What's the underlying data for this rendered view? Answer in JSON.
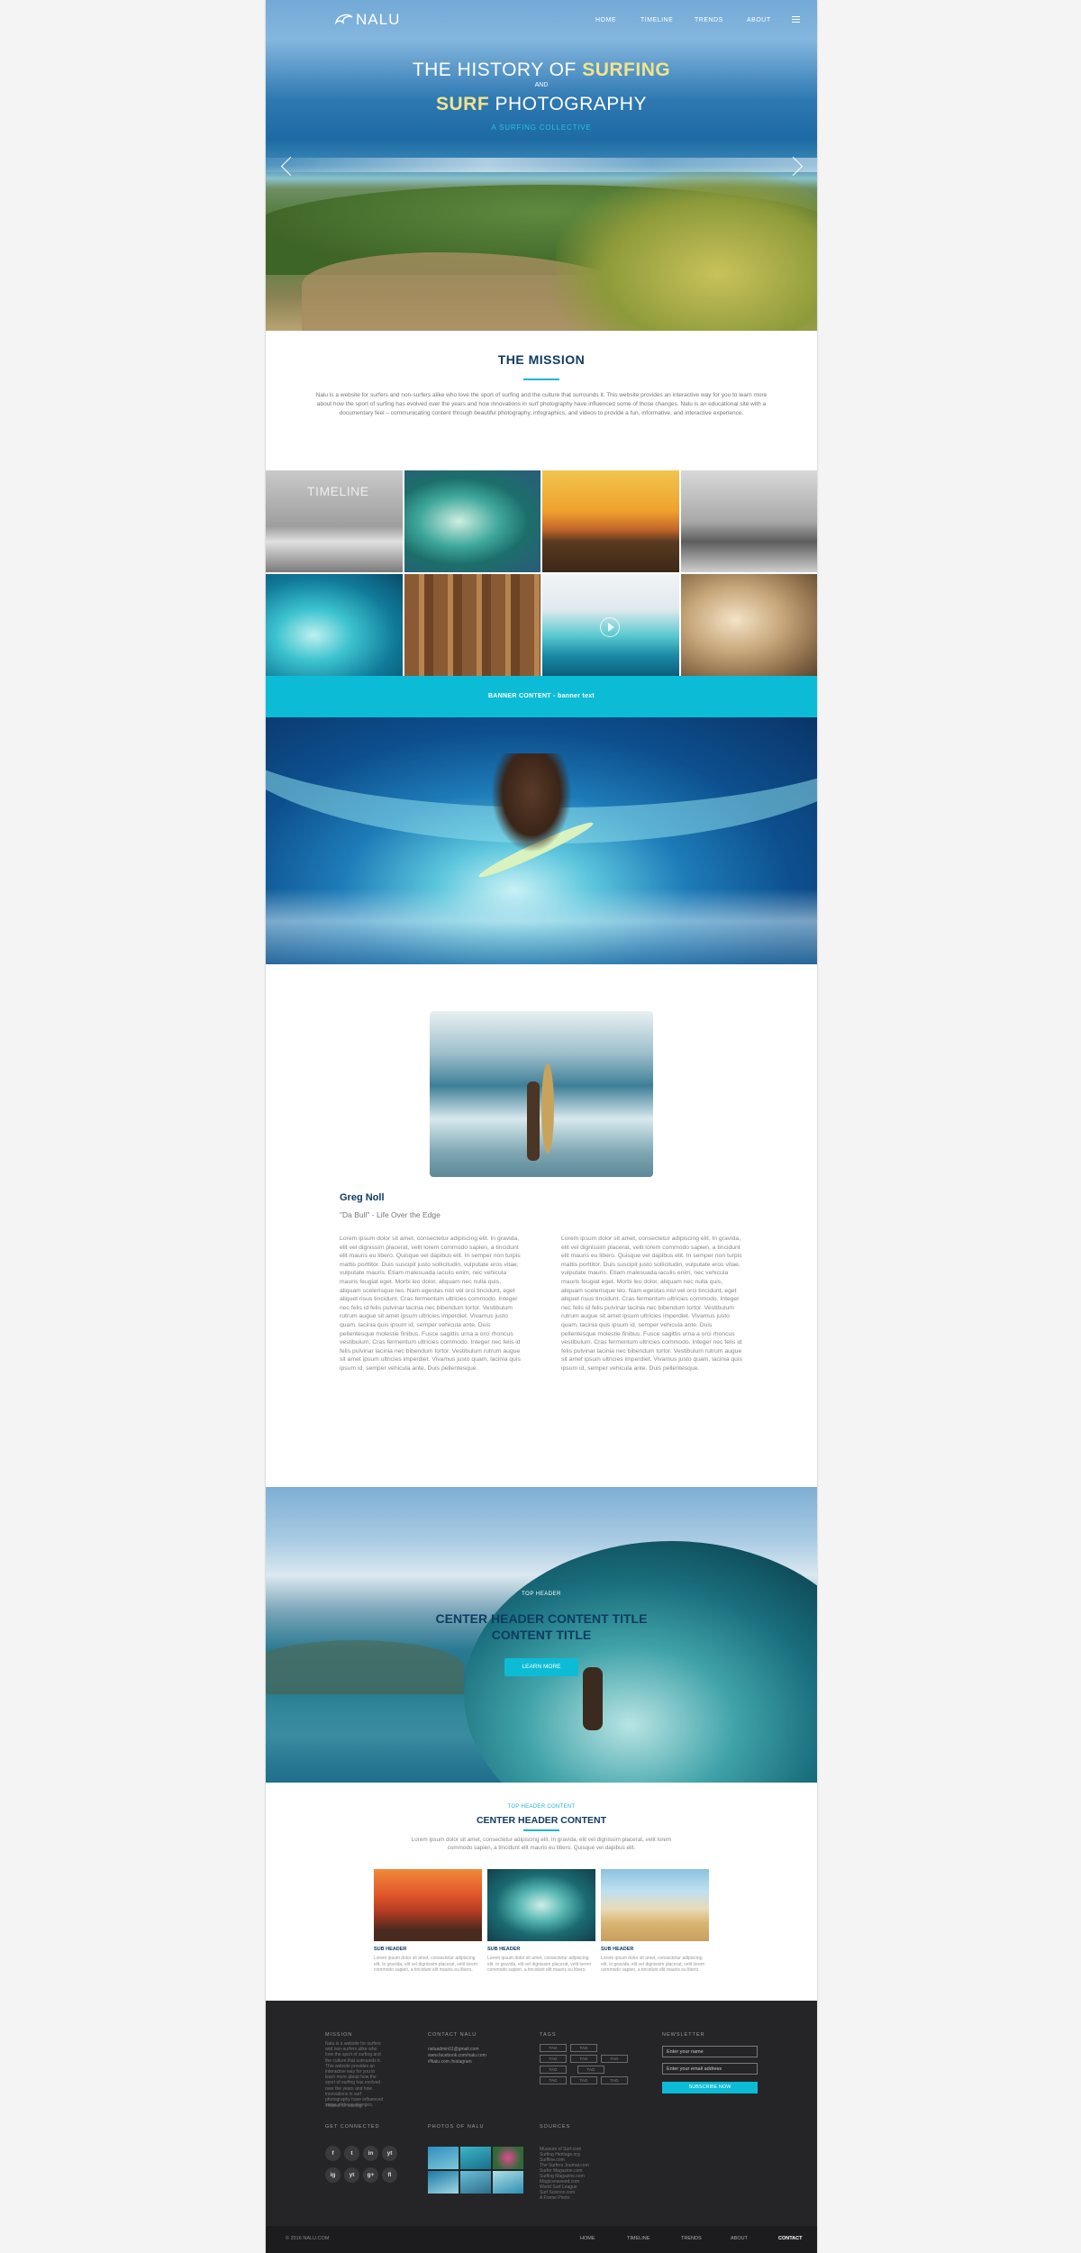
{
  "brand": {
    "name": "NALU"
  },
  "nav": {
    "home": "HOME",
    "timeline": "TIMELINE",
    "trends": "TRENDS",
    "about": "ABOUT"
  },
  "hero": {
    "title_pre": "THE HISTORY OF ",
    "title_hl": "SURFING",
    "and": "AND",
    "title2_hl": "SURF",
    "title2_post": " PHOTOGRAPHY",
    "subtitle": "A SURFING COLLECTIVE"
  },
  "mission": {
    "title": "THE MISSION",
    "text": "Nalu is a website for surfers and non-surfers alike who love the sport of surfing and the culture that surrounds it. This website provides an interactive way for you to learn more about how the sport of surfing has evolved over the years and how innovations in surf photography have influenced some of those changes. Nalu is an educational site with a documentary feel – communicating content through beautiful photography, infographics, and videos to provide a fun, informative, and interactive experience."
  },
  "grid": {
    "timeline_label": "TIMELINE"
  },
  "banner": {
    "text": "BANNER CONTENT - banner text"
  },
  "profile": {
    "name": "Greg Noll",
    "quote": "\"Da Bull\" - Life Over the Edge",
    "col1": "Lorem ipsum dolor sit amet, consectetur adipiscing elit. In gravida, elit vel dignissim placerat, velit lorem commodo sapien, a tincidunt elit mauris eu libero. Quisque vel dapibus elit. In semper non turpis mattis porttitor. Duis suscipit justo sollicitudin, vulputate eros vitae, vulputate mauris. Etiam malesuada iaculis enim, nec vehicula mauris feugiat eget. Morbi leo dolor, aliquam nec nulla quis, aliquam scelerisque leo. Nam egestas nisl vel orci tincidunt, eget aliquet risus tincidunt. Cras fermentum ultricies commodo. Integer nec felis id felis pulvinar lacinia nec bibendum tortor. Vestibulum rutrum augue sit amet ipsum ultricies imperdiet. Vivamus justo quam, lacinia quis ipsum id, semper vehicula ante. Duis pellentesque molestie finibus. Fusce sagittis urna a orci rhoncus vestibulum. Cras fermentum ultricies commodo. Integer nec felis id felis pulvinar lacinia nec bibendum tortor. Vestibulum rutrum augue sit amet ipsum ultricies imperdiet. Vivamus justo quam, lacinia quis ipsum id, semper vehicula ante. Duis pellentesque.",
    "col2": "Lorem ipsum dolor sit amet, consectetur adipiscing elit. In gravida, elit vel dignissim placerat, velit lorem commodo sapien, a tincidunt elit mauris eu libero. Quisque vel dapibus elit. In semper non turpis mattis porttitor. Duis suscipit justo sollicitudin, vulputate eros vitae, vulputate mauris. Etiam malesuada iaculis enim, nec vehicula mauris feugiat eget. Morbi leo dolor, aliquam nec nulla quis, aliquam scelerisque leo. Nam egestas nisl vel orci tincidunt, eget aliquet risus tincidunt. Cras fermentum ultricies commodo. Integer nec felis id felis pulvinar lacinia nec bibendum tortor. Vestibulum rutrum augue sit amet ipsum ultricies imperdiet. Vivamus justo quam, lacinia quis ipsum id, semper vehicula ante. Duis pellentesque molestie finibus. Fusce sagittis urna a orci rhoncus vestibulum. Cras fermentum ultricies commodo. Integer nec felis id felis pulvinar lacinia nec bibendum tortor. Vestibulum rutrum augue sit amet ipsum ultricies imperdiet. Vivamus justo quam, lacinia quis ipsum id, semper vehicula ante. Duis pellentesque."
  },
  "feature": {
    "kicker": "TOP HEADER",
    "title": "CENTER HEADER CONTENT TITLE CONTENT TITLE",
    "button": "LEARN MORE"
  },
  "cards_section": {
    "kicker": "TOP HEADER CONTENT",
    "title": "CENTER HEADER CONTENT",
    "text": "Lorem ipsum dolor sit amet, consectetur adipiscing elit. In gravida, elit vel dignissim placerat, velit lorem commodo sapien, a tincidunt elit mauris eu libero. Quisque vel dapibus elit.",
    "cards": [
      {
        "sub": "SUB HEADER",
        "text": "Lorem ipsum dolor sit amet, consectetur adipiscing elit. In gravida, elit vel dignissim placerat, velit lorem commodo sapien, a tincidunt elit mauris eu libero."
      },
      {
        "sub": "SUB HEADER",
        "text": "Lorem ipsum dolor sit amet, consectetur adipiscing elit. In gravida, elit vel dignissim placerat, velit lorem commodo sapien, a tincidunt elit mauris eu libero."
      },
      {
        "sub": "SUB HEADER",
        "text": "Lorem ipsum dolor sit amet, consectetur adipiscing elit. In gravida, elit vel dignissim placerat, velit lorem commodo sapien, a tincidunt elit mauris eu libero."
      }
    ]
  },
  "footer": {
    "mission_heading": "MISSION",
    "mission_text": "Nalu is a website for surfers and non-surfers alike who love the sport of surfing and the culture that surrounds it. This website provides an interactive way for you to learn more about how the sport of surfing has evolved over the years and how innovations in surf photography have influenced some of those changes.",
    "thanks": "Thanks for visiting.",
    "contact_heading": "CONTACT NALU",
    "contact_lines": [
      "naluadmin01@gmail.com",
      "www.facebook.com/nalu.com",
      "#Nalu.com /instagram"
    ],
    "tags_heading": "TAGS",
    "tags": [
      "TAG",
      "TAG",
      "TAG",
      "TAG",
      "TAG",
      "TAG",
      "TAG",
      "TAG",
      "TAG",
      "TAG",
      "TAG",
      "TAG"
    ],
    "newsletter_heading": "NEWSLETTER",
    "name_placeholder": "Enter your name",
    "email_placeholder": "Enter your email address",
    "subscribe": "SUBSCRIBE NOW",
    "connected_heading": "GET CONNECTED",
    "social": [
      "f",
      "t",
      "in",
      "yt",
      "ig",
      "yt",
      "g+",
      "fl"
    ],
    "photos_heading": "PHOTOS OF NALU",
    "sources_heading": "SOURCES",
    "sources": [
      "Museum of Surf.com",
      "Surfing Heritage.org",
      "Surfline.com",
      "The Surfers Journal.com",
      "Surfer Magazine.com",
      "Surfing Magazine.com",
      "Magicseaweed.com",
      "World Surf League",
      "Surf Science.com",
      "A Frame Photo"
    ],
    "copyright": "© 2016 NALU.COM",
    "nav": [
      "HOME",
      "TIMELINE",
      "TRENDS",
      "ABOUT",
      "CONTACT"
    ]
  }
}
